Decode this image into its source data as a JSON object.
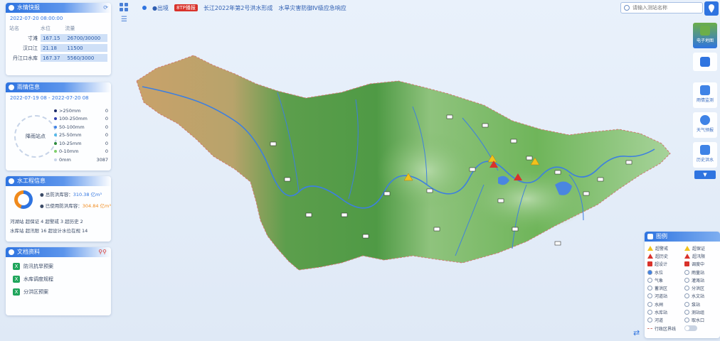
{
  "topbar": {
    "ticker": [
      "●出境",
      "8TP播报",
      "长江2022年第2号洪水形成",
      "水旱灾害防御Ⅳ级应急响应"
    ],
    "search_placeholder": "请输入测站名称",
    "pin_label": "↓"
  },
  "panel_level": {
    "title": "水情快报",
    "date": "2022-07-20 08:00:00",
    "headers": [
      "站名",
      "水位",
      "流量"
    ],
    "rows": [
      {
        "name": "寸滩",
        "level": "167.15",
        "flow": "26700/30000"
      },
      {
        "name": "汉口江",
        "level": "21.18",
        "flow": "11500"
      },
      {
        "name": "丹江口水库",
        "level": "167.37",
        "flow": "5560/3000"
      }
    ]
  },
  "panel_rain": {
    "title": "雨情信息",
    "range": "2022-07-19 08 - 2022-07-20 08",
    "center": "降雨站点",
    "legend": [
      {
        "label": ">250mm",
        "count": "0",
        "color": "#1b2b6b"
      },
      {
        "label": "100-250mm",
        "count": "0",
        "color": "#2f3fb0"
      },
      {
        "label": "50-100mm",
        "count": "0",
        "color": "#3f83e6"
      },
      {
        "label": "25-50mm",
        "count": "0",
        "color": "#53b8e8"
      },
      {
        "label": "10-25mm",
        "count": "0",
        "color": "#2e8b3d"
      },
      {
        "label": "0-10mm",
        "count": "0",
        "color": "#7fcf6b"
      },
      {
        "label": "0mm",
        "count": "3087",
        "color": "#c7d4e8"
      }
    ]
  },
  "panel_works": {
    "title": "水工程信息",
    "cap1": "● 总防洪库容：",
    "cap1_val": "310.38 亿m³",
    "cap2": "● 已使用防洪库容：",
    "cap2_val": "304.84 亿m³",
    "row1": "河湖站  超保证 4  超警戒 3  超历史 2",
    "row2": "水库站  超汛限 16  超设计水位在规 14"
  },
  "panel_files": {
    "title": "文档资料",
    "items": [
      "防汛抗旱预案",
      "水库调度规程",
      "分洪区预案"
    ]
  },
  "sidebar": {
    "items": [
      "电子地图",
      "",
      "雨情监测",
      "天气预报",
      "历史洪水"
    ],
    "down": "▼"
  },
  "legend": {
    "title": "图例",
    "items": [
      "超警戒",
      "超保证",
      "超历史",
      "超汛限",
      "超设计",
      "调度中",
      "水位",
      "雨量站",
      "气象",
      "灌溉站",
      "蓄洪区",
      "分洪区",
      "河道站",
      "水文站",
      "水闸",
      "泵站",
      "水库站",
      "测站组",
      "河道",
      "取水口",
      "行政区界线"
    ]
  },
  "colors": {
    "accent": "#2f74e0",
    "warn": "#f2c21b",
    "danger": "#d9322b",
    "ok": "#1fa55b"
  }
}
